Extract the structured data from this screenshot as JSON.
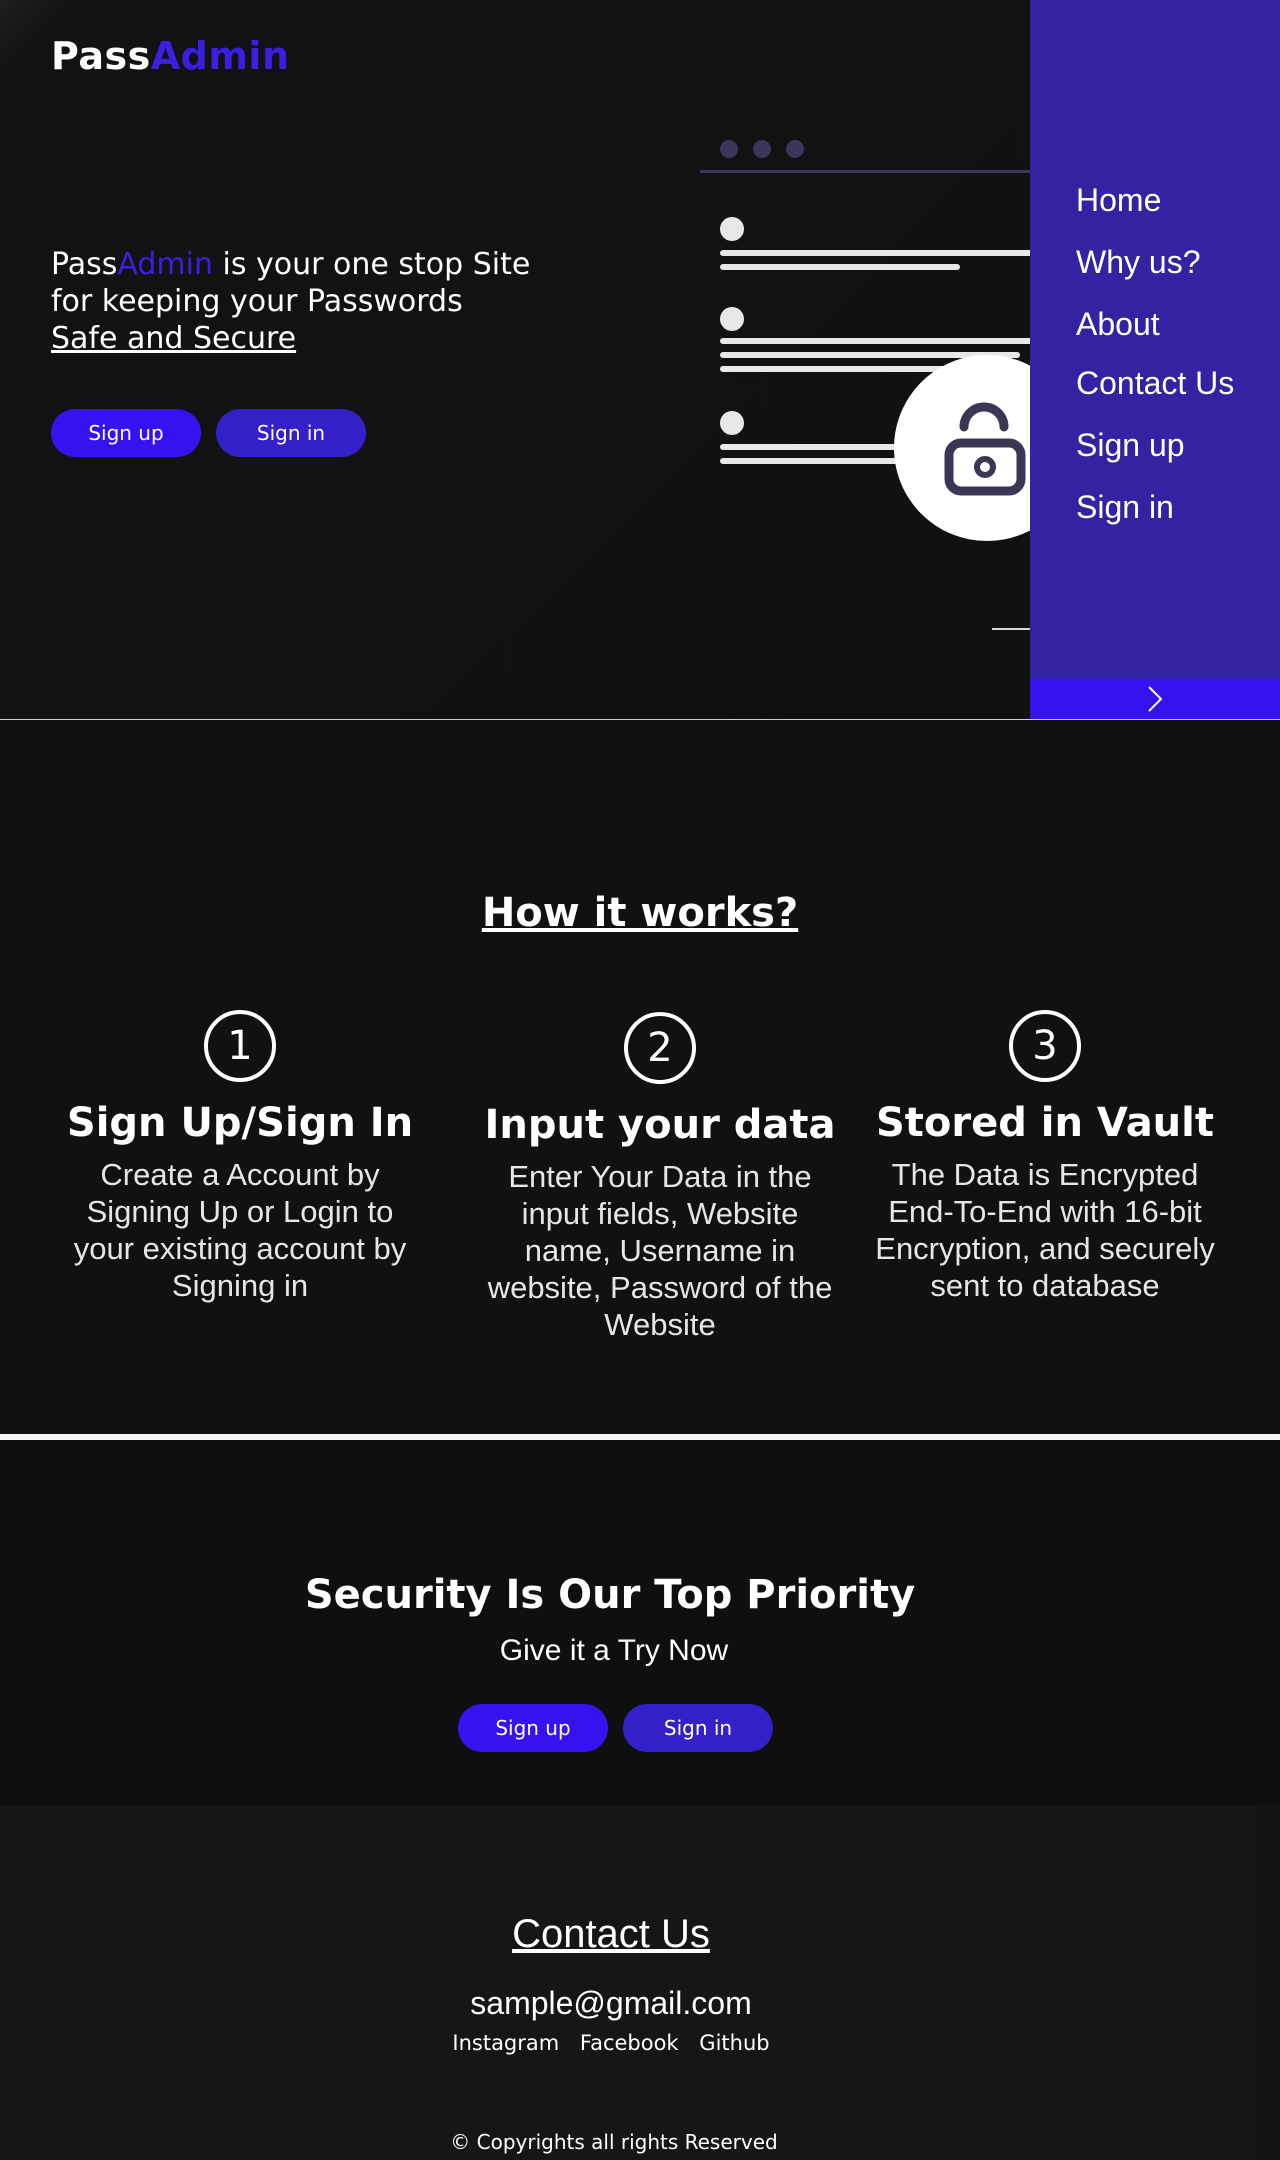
{
  "brand": {
    "part1": "Pass",
    "part2": "Admin",
    "accent_color": "#3b1fe0"
  },
  "hero": {
    "tagline_brand1": "Pass",
    "tagline_brand2": "Admin",
    "tagline_rest": " is your one stop Site for keeping your Passwords",
    "tagline_underlined": "Safe and Secure",
    "signup_label": "Sign up",
    "signin_label": "Sign in",
    "illustration_icon": "padlock-open-icon"
  },
  "nav": {
    "items": [
      "Home",
      "Why us?",
      "About",
      "Contact Us",
      "Sign up",
      "Sign in"
    ],
    "toggle_icon": "chevron-right-icon",
    "bg_color": "#3223a3"
  },
  "how": {
    "title": "How it works?",
    "steps": [
      {
        "number": "1",
        "title": "Sign Up/Sign In",
        "text": "Create a Account by Signing Up or Login to your existing account by Signing in"
      },
      {
        "number": "2",
        "title": "Input your data",
        "text": "Enter Your Data in the input fields, Website name, Username in website, Password of the Website"
      },
      {
        "number": "3",
        "title": "Stored in Vault",
        "text": "The Data is Encrypted End-To-End with 16-bit Encryption, and securely sent to database"
      }
    ]
  },
  "security": {
    "title": "Security Is Our Top Priority",
    "subtitle": "Give it a Try Now",
    "signup_label": "Sign up",
    "signin_label": "Sign in"
  },
  "contact": {
    "title": "Contact Us",
    "email": "sample@gmail.com",
    "links": [
      "Instagram",
      "Facebook",
      "Github"
    ],
    "copyright": "© Copyrights all rights Reserved"
  },
  "colors": {
    "primary_button": "#3512f0",
    "secondary_button": "#3420c9"
  }
}
